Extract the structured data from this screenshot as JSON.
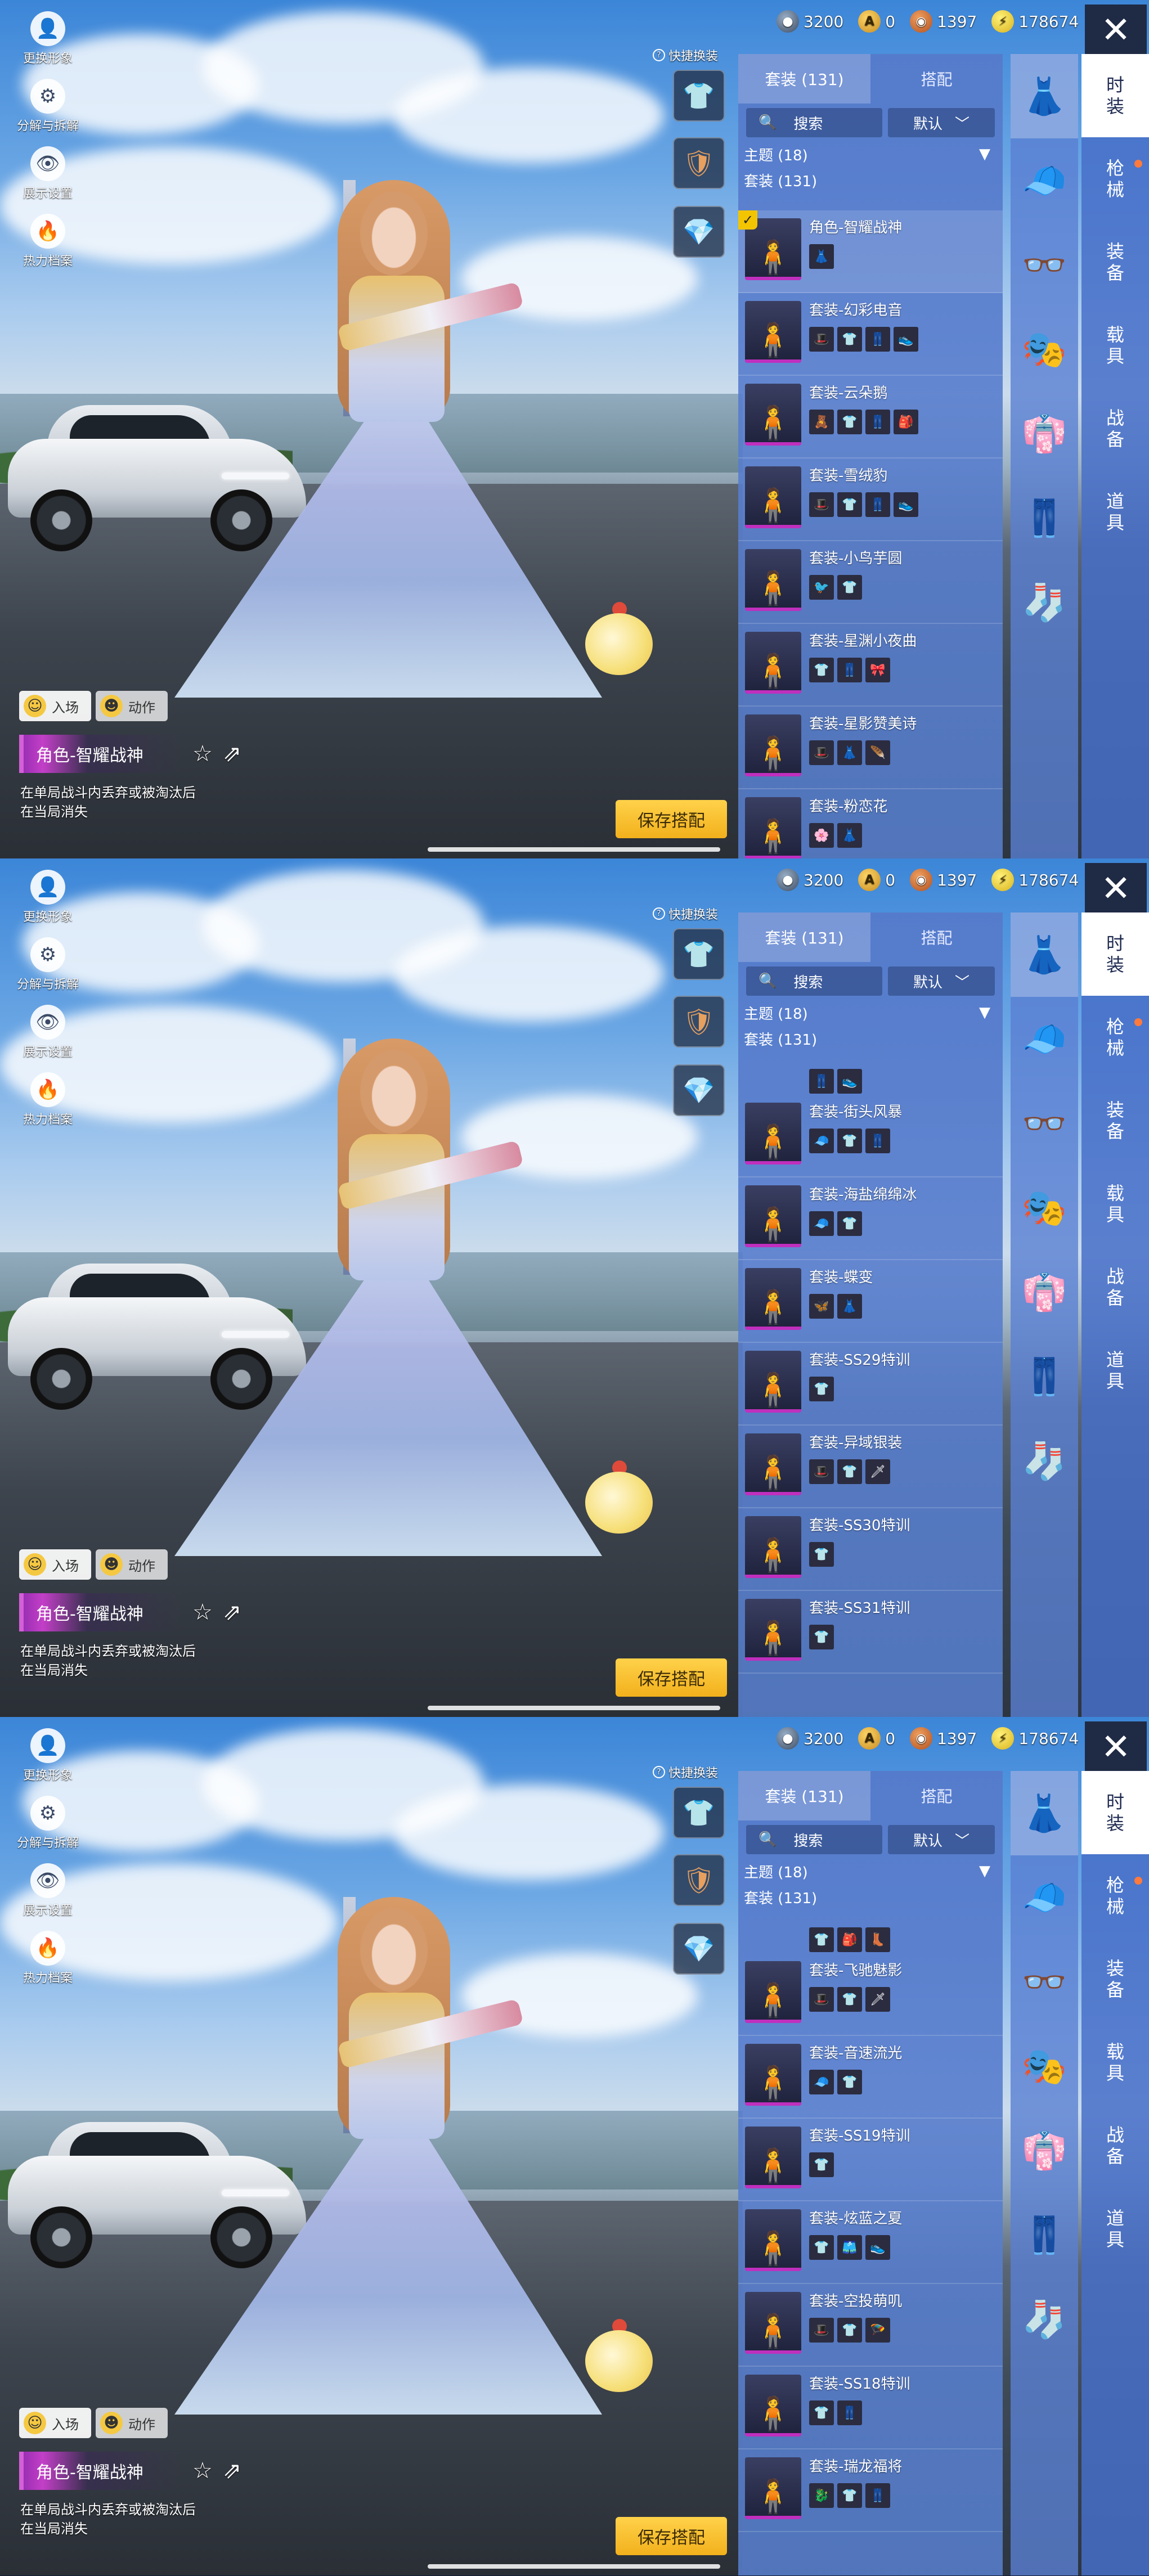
{
  "common": {
    "tools": [
      {
        "label": "更换形象",
        "icon": "person-icon",
        "glyph": "👤"
      },
      {
        "label": "分解与拆解",
        "icon": "gear-icon",
        "glyph": "⚙"
      },
      {
        "label": "展示设置",
        "icon": "eye-icon",
        "glyph": "👁"
      },
      {
        "label": "热力档案",
        "icon": "flame-icon",
        "glyph": "🔥"
      }
    ],
    "quick_change_label": "快捷换装",
    "quick_buttons": [
      {
        "icon": "hanger-icon",
        "glyph": "👕"
      },
      {
        "icon": "badge-icon",
        "glyph": "🛡"
      },
      {
        "icon": "diamond-icon",
        "glyph": "💎"
      }
    ],
    "action_buttons": [
      {
        "label": "入场",
        "icon": "smile-icon",
        "glyph": "☺"
      },
      {
        "label": "动作",
        "icon": "pose-icon",
        "glyph": "☻"
      }
    ],
    "outfit_name": "角色-智耀战神",
    "note_line1": "在单局战斗内丢弃或被淘汰后",
    "note_line2": "在当局消失",
    "save_label": "保存搭配",
    "currency": [
      {
        "value": "3200",
        "icon": "silver-coin-icon",
        "glyph": "●"
      },
      {
        "value": "0",
        "icon": "gold-a-icon",
        "glyph": "A"
      },
      {
        "value": "1397",
        "icon": "copper-coin-icon",
        "glyph": "◉"
      },
      {
        "value": "178674",
        "icon": "bolt-coin-icon",
        "glyph": "⚡"
      }
    ],
    "close_glyph": "✕",
    "tabs": [
      "套装 (131)",
      "搭配"
    ],
    "search_label": "搜索",
    "search_glyph": "🔍",
    "sort_label": "默认",
    "sort_glyph": "﹀",
    "theme_label": "主题 (18)",
    "theme_glyph": "▼",
    "set_count_label": "套装 (131)",
    "slot_icons": [
      {
        "icon": "outfit-icon",
        "glyph": "👗"
      },
      {
        "icon": "cap-icon",
        "glyph": "🧢"
      },
      {
        "icon": "glasses-icon",
        "glyph": "👓"
      },
      {
        "icon": "mask-icon",
        "glyph": "🎭"
      },
      {
        "icon": "dress-icon",
        "glyph": "👘"
      },
      {
        "icon": "pants-icon",
        "glyph": "👖"
      },
      {
        "icon": "socks-icon",
        "glyph": "🧦"
      }
    ],
    "categories": [
      "时装",
      "枪械",
      "装备",
      "载具",
      "战备",
      "道具"
    ],
    "colors": {
      "accent_yellow": "#f2b01c",
      "purple_rarity": "#c02fbe",
      "panel_blue": "#567aca",
      "badge_orange": "#ff7a3d"
    }
  },
  "panels": [
    {
      "peek": false,
      "items": [
        {
          "name": "角色-智耀战神",
          "minis": [
            "👗"
          ],
          "selected": true
        },
        {
          "name": "套装-幻彩电音",
          "minis": [
            "🎩",
            "👕",
            "👖",
            "👟"
          ]
        },
        {
          "name": "套装-云朵鹅",
          "minis": [
            "🧸",
            "👕",
            "👖",
            "🎒"
          ]
        },
        {
          "name": "套装-雪绒豹",
          "minis": [
            "🎩",
            "👕",
            "👖",
            "👟"
          ]
        },
        {
          "name": "套装-小鸟芋圆",
          "minis": [
            "🐦",
            "👕"
          ]
        },
        {
          "name": "套装-星渊小夜曲",
          "minis": [
            "👕",
            "👖",
            "🎀"
          ]
        },
        {
          "name": "套装-星影赞美诗",
          "minis": [
            "🎩",
            "👗",
            "🪶"
          ]
        },
        {
          "name": "套装-粉恋花",
          "minis": [
            "🌸",
            "👗"
          ]
        }
      ]
    },
    {
      "peek": true,
      "peek_minis": [
        "👖",
        "👟"
      ],
      "items": [
        {
          "name": "套装-街头风暴",
          "minis": [
            "🧢",
            "👕",
            "👖"
          ]
        },
        {
          "name": "套装-海盐绵绵冰",
          "minis": [
            "🧢",
            "👕"
          ]
        },
        {
          "name": "套装-蝶变",
          "minis": [
            "🦋",
            "👗"
          ]
        },
        {
          "name": "套装-SS29特训",
          "minis": [
            "👕"
          ]
        },
        {
          "name": "套装-异域银装",
          "minis": [
            "🎩",
            "👕",
            "🗡"
          ]
        },
        {
          "name": "套装-SS30特训",
          "minis": [
            "👕"
          ]
        },
        {
          "name": "套装-SS31特训",
          "minis": [
            "👕"
          ]
        }
      ]
    },
    {
      "peek": true,
      "peek_minis": [
        "👕",
        "🎒",
        "👢"
      ],
      "items": [
        {
          "name": "套装-飞驰魅影",
          "minis": [
            "🎩",
            "👕",
            "🗡"
          ]
        },
        {
          "name": "套装-音速流光",
          "minis": [
            "🧢",
            "👕"
          ]
        },
        {
          "name": "套装-SS19特训",
          "minis": [
            "👕"
          ]
        },
        {
          "name": "套装-炫蓝之夏",
          "minis": [
            "👕",
            "🩳",
            "👟"
          ]
        },
        {
          "name": "套装-空投萌叽",
          "minis": [
            "🎩",
            "👕",
            "🪂"
          ]
        },
        {
          "name": "套装-SS18特训",
          "minis": [
            "👕",
            "👖"
          ]
        },
        {
          "name": "套装-瑞龙福将",
          "minis": [
            "🐉",
            "👕",
            "👖"
          ]
        }
      ]
    }
  ]
}
